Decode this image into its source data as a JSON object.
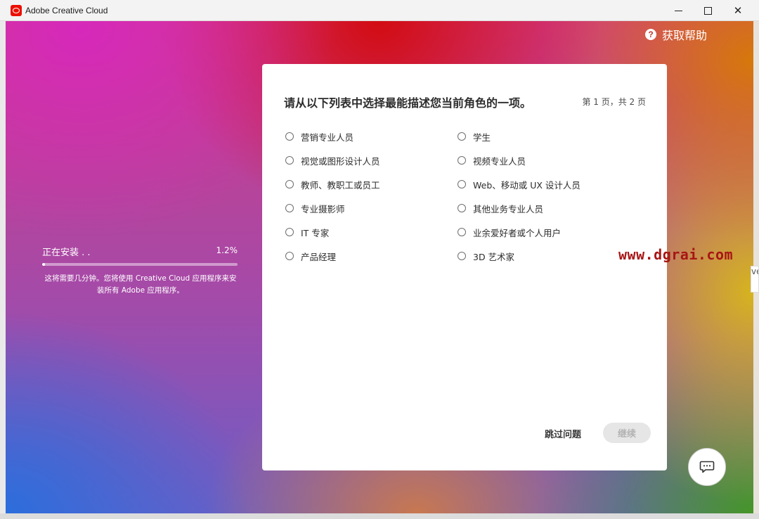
{
  "window": {
    "title": "Adobe Creative Cloud",
    "minimize": "—",
    "maximize": "□",
    "close": "✕"
  },
  "help": {
    "label": "获取帮助",
    "icon": "?"
  },
  "install": {
    "status": "正在安装 . .",
    "percent_text": "1.2%",
    "progress": 0.012,
    "note": "这将需要几分钟。您将使用 Creative Cloud 应用程序来安装所有 Adobe 应用程序。"
  },
  "dialog": {
    "question": "请从以下列表中选择最能描述您当前角色的一项。",
    "page": "第 1 页，共 2 页",
    "options_left": [
      "营销专业人员",
      "视觉或图形设计人员",
      "教师、教职工或员工",
      "专业摄影师",
      "IT 专家",
      "产品经理"
    ],
    "options_right": [
      "学生",
      "视频专业人员",
      "Web、移动或 UX 设计人员",
      "其他业务专业人员",
      "业余爱好者或个人用户",
      "3D 艺术家"
    ],
    "skip_label": "跳过问题",
    "continue_label": "继续"
  },
  "watermark": "www.dgrai.com",
  "edge_text": "ve",
  "icons": {
    "help": "question-circle-icon",
    "chat": "chat-bubble-icon",
    "app": "creative-cloud-logo-icon"
  },
  "colors": {
    "adobe_red": "#eb1000",
    "watermark": "#a81515"
  }
}
